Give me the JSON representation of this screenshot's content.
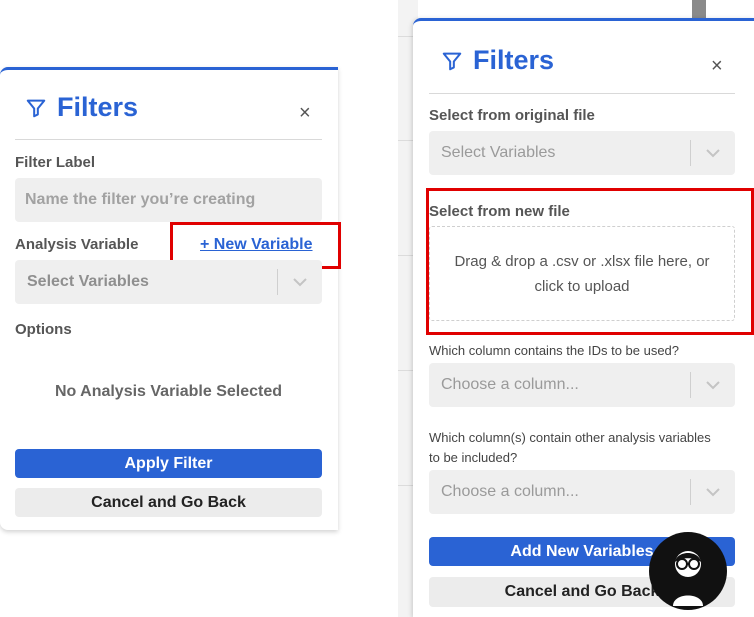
{
  "left_panel": {
    "title": "Filters",
    "close_label": "×",
    "filter_label": "Filter Label",
    "filter_placeholder": "Name the filter you’re creating",
    "analysis_variable_label": "Analysis Variable",
    "new_variable_link": "+ New Variable",
    "select_placeholder": "Select Variables",
    "options_label": "Options",
    "empty_message": "No Analysis Variable Selected",
    "apply_button": "Apply Filter",
    "cancel_button": "Cancel and Go Back"
  },
  "right_panel": {
    "title": "Filters",
    "close_label": "×",
    "original_file_label": "Select from original file",
    "select_placeholder": "Select Variables",
    "new_file_label": "Select from new file",
    "dropzone_text": "Drag & drop a .csv or .xlsx file here, or click to upload",
    "id_column_question": "Which column contains the IDs to be used?",
    "id_column_placeholder": "Choose a column...",
    "other_columns_question": "Which column(s) contain other analysis variables to be included?",
    "other_columns_placeholder": "Choose a column...",
    "add_button": "Add New Variables",
    "cancel_button": "Cancel and Go Back"
  },
  "icons": {
    "filter": "filter-funnel-icon",
    "close": "close-icon",
    "chevron": "chevron-down-icon",
    "avatar": "avatar-icon"
  },
  "colors": {
    "accent": "#2a63d4",
    "highlight": "#e00000"
  }
}
